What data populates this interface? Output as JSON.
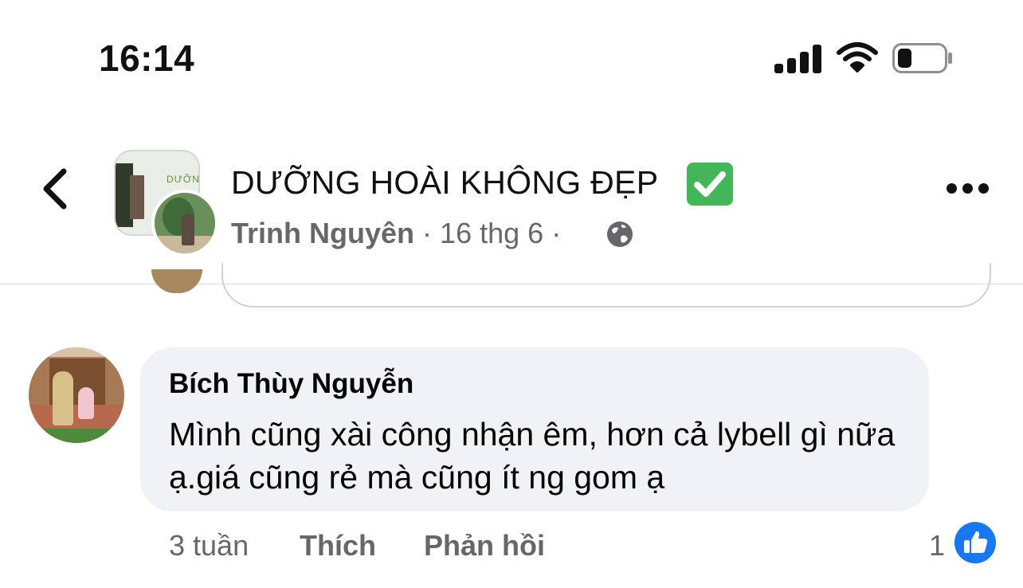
{
  "status_bar": {
    "time": "16:14",
    "signal_icon": "cellular-signal-icon",
    "wifi_icon": "wifi-icon",
    "battery_icon": "battery-low-icon",
    "battery_level_fraction": 0.2
  },
  "header": {
    "back_icon": "chevron-left-icon",
    "page_name": "DƯỠNG HOÀI KHÔNG ĐẸP",
    "verified_icon": "green-checkmark-box-icon",
    "author": "Trinh Nguyên",
    "separator": "·",
    "date": "16 thg 6",
    "privacy_icon": "globe-icon",
    "more_icon": "more-horizontal-icon"
  },
  "comment": {
    "author": "Bích Thùy Nguyễn",
    "text": "Mình cũng xài công nhận êm, hơn cả lybell gì nữa ạ.giá cũng rẻ mà cũng ít ng gom ạ",
    "time_ago": "3 tuần",
    "like_label": "Thích",
    "reply_label": "Phản hồi",
    "reaction_count": "1",
    "reaction_icon": "thumbs-up-icon"
  },
  "colors": {
    "bubble_bg": "#f0f2f5",
    "meta_text": "#65676b",
    "like_blue": "#0a64e0",
    "verified_green": "#44b65a"
  }
}
